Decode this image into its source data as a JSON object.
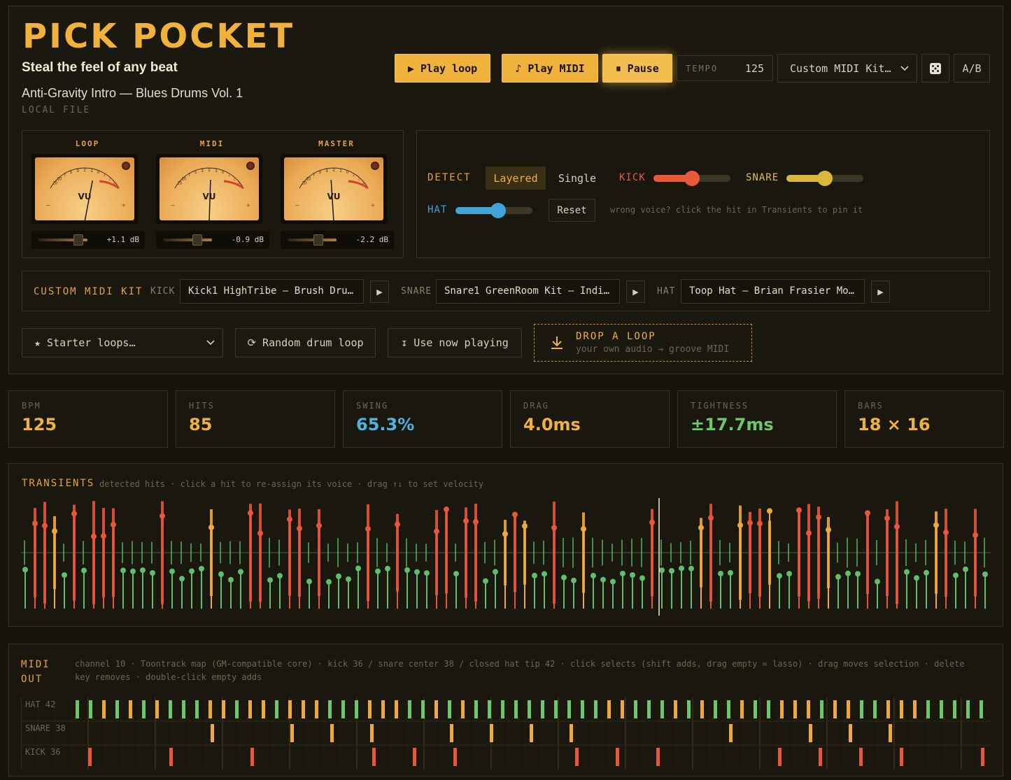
{
  "app": {
    "title": "PICK POCKET",
    "tagline": "Steal the feel of any beat",
    "track_name": "Anti-Gravity Intro — Blues Drums Vol. 1",
    "source": "LOCAL FILE"
  },
  "transport": {
    "play_loop": "▶ Play loop",
    "play_midi": "♪ Play MIDI",
    "pause": "⏸ Pause",
    "tempo_label": "TEMPO",
    "tempo_value": "125",
    "kit_select": "Custom MIDI Kit…",
    "dice_icon": "dice-icon",
    "ab": "A/B"
  },
  "meters": [
    {
      "label": "LOOP",
      "db": "+1.1 dB",
      "level": 0.62
    },
    {
      "label": "MIDI",
      "db": "-0.9 dB",
      "level": 0.52
    },
    {
      "label": "MASTER",
      "db": "-2.2 dB",
      "level": 0.46
    }
  ],
  "vu_text": "VU",
  "detect": {
    "label": "DETECT",
    "mode_layered": "Layered",
    "mode_single": "Single",
    "kick_label": "KICK",
    "kick_value": 0.5,
    "snare_label": "SNARE",
    "snare_value": 0.5,
    "hat_label": "HAT",
    "hat_value": 0.55,
    "reset": "Reset",
    "hint": "wrong voice? click the hit in Transients to pin it",
    "colors": {
      "kick": "#e85a3a",
      "snare": "#d8b73c",
      "hat": "#3fa2d8"
    }
  },
  "custom_kit": {
    "label": "CUSTOM MIDI KIT",
    "kick_label": "KICK",
    "kick_value": "Kick1 HighTribe — Brush Dru…",
    "snare_label": "SNARE",
    "snare_value": "Snare1 GreenRoom Kit — Indi…",
    "hat_label": "HAT",
    "hat_value": "Toop Hat — Brian Frasier Mo…"
  },
  "loaders": {
    "starter": "★ Starter loops…",
    "random": "⟳ Random drum loop",
    "use_now": "↧ Use now playing",
    "drop_title": "DROP A LOOP",
    "drop_sub": "your own audio → groove MIDI"
  },
  "stats": [
    {
      "key": "BPM",
      "value": "125",
      "color": "#f0b23b"
    },
    {
      "key": "HITS",
      "value": "85",
      "color": "#f0b23b"
    },
    {
      "key": "SWING",
      "value": "65.3%",
      "color": "#4fb3e0"
    },
    {
      "key": "DRAG",
      "value": "4.0ms",
      "color": "#f0b23b"
    },
    {
      "key": "TIGHTNESS",
      "value": "±17.7ms",
      "color": "#6cc86a"
    },
    {
      "key": "BARS",
      "value": "18 × 16",
      "color": "#f0b23b"
    }
  ],
  "transients": {
    "title": "TRANSIENTS",
    "hint": "detected hits · click a hit to re-assign its voice · drag ↑↓ to set velocity"
  },
  "midi_out": {
    "title_line1": "MIDI",
    "title_line2": "OUT",
    "info": "channel 10 · Toontrack map (GM-compatible core) · kick 36 / snare center 38 / closed hat tip 42 · click selects (shift adds, drag empty = lasso) · drag moves selection · delete key removes · double-click empty adds",
    "lanes": [
      "HAT 42",
      "SNARE 38",
      "KICK 36"
    ]
  }
}
